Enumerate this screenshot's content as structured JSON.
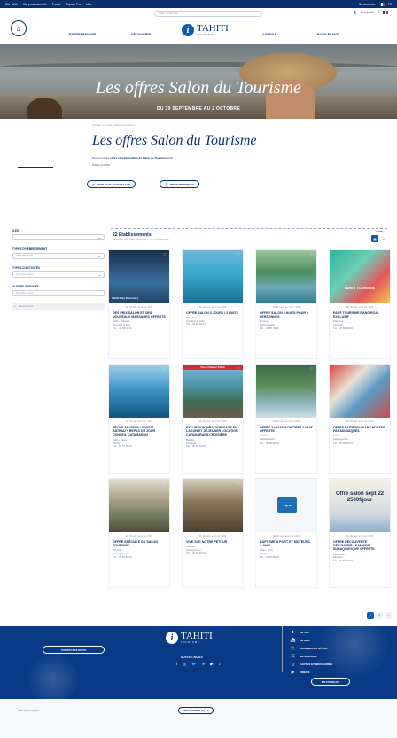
{
  "topbar": {
    "links": [
      "Site Tahiti",
      "Site professionnels",
      "Presse",
      "Espace Pro",
      "Mice"
    ],
    "right_text": "Se connecter",
    "lang": "FR"
  },
  "header": {
    "search_placeholder": "Votre recherche...",
    "login": "Connexion",
    "nav": [
      "ENTREPRENDRE",
      "DÉCOUVRIR",
      "AGENDA",
      "BONS PLANS"
    ],
    "logo_word": "TAHITI",
    "logo_sub": "TOURISME"
  },
  "hero": {
    "title": "Les offres Salon du Tourisme",
    "dates": "DU 30 SEPTEMBRE AU 2 OCTOBRE"
  },
  "intro": {
    "breadcrumb": "Accueil > Les offres Salon du Tourisme",
    "title": "Les offres Salon du Tourisme",
    "text_prefix": "Découvrez les",
    "text_bold": "offres exceptionnelles du Salon du Tourisme",
    "text_suffix": "2022",
    "date": "Publié le 01/09",
    "btn_map": "VOIR LE PLAN DU SALON",
    "btn_info": "INFOS PRATIQUES"
  },
  "filters": {
    "items": [
      {
        "label": "ÎLES",
        "value": ""
      },
      {
        "label": "TYPES D'HÉBERGEMENT",
        "value": "Tous les types"
      },
      {
        "label": "TYPES D'ACTIVITÉS",
        "value": "Tous les types"
      },
      {
        "label": "AUTRES SERVICES",
        "value": "Tous les types"
      }
    ],
    "search_placeholder": "Rechercher"
  },
  "results": {
    "count": "22 Établissements",
    "subtitle": "Résultats pour votre recherche — 22 offres au total",
    "view_label": "LISTE"
  },
  "cards": [
    {
      "date": "Du 30 sept. au 2 oct. 2022",
      "title": "DES PRIX SALON ET DES NOUVEAUX MASSAGES OFFERTS",
      "meta": [
        "Tahiti - Papeete",
        "Bien-être & Spa",
        "Tél. : 40 50 10 00"
      ],
      "img": "whale",
      "img_text": "Tahiti Dive Discovery"
    },
    {
      "date": "Du 30 sept. au 2 oct. 2022",
      "title": "OFFRE SALON 3 JOURS / 2 NUITS",
      "meta": [
        "Bora Bora",
        "Croisière & Voile",
        "Tél. : 40 60 20 00"
      ],
      "img": "lagoon",
      "img_text": ""
    },
    {
      "date": "Du 30 sept. au 2 oct. 2022",
      "title": "OFFRE SALON 3 NUITS POUR 2 PERSONNES",
      "meta": [
        "Moorea",
        "Hébergement",
        "Tél. : 40 55 10 10"
      ],
      "img": "resort",
      "img_text": ""
    },
    {
      "date": "Du 30 sept. au 2 oct. 2022",
      "title": "PASS TOURISME RANGIROA EXCLUSIF",
      "meta": [
        "Rangiroa",
        "Activités",
        "Tél. : 40 96 00 00"
      ],
      "img": "pass",
      "img_text": "TAHITI TOURISME"
    },
    {
      "date": "Du 30 sept. au 2 oct. 2022",
      "title": "PÊCHE AU GROS / SORTIE BATEAU + REPAS DU JOUR CONSEIL CATAMARAN",
      "meta": [
        "Tahiti - Faa'a",
        "Pêche",
        "Tél. : 87 70 00 00"
      ],
      "img": "boat",
      "img_text": ""
    },
    {
      "date": "Du 30 sept. au 2 oct. 2022",
      "title": "EXCURSION PIRATAGE NAGE EN LAGON ET DÉJEUNER LOCATION CATAMARANS CROISIÈRE",
      "meta": [
        "Raiatea",
        "Croisière",
        "Tél. : 40 66 00 00"
      ],
      "img": "pier",
      "img_text": "Pass Charter Tahiti"
    },
    {
      "date": "Du 30 sept. au 2 oct. 2022",
      "title": "OFFRE 3 NUITS ACHETÉES 1 NUIT OFFERTE",
      "meta": [
        "Huahine",
        "Hébergement",
        "Tél. : 40 68 00 00"
      ],
      "img": "palms",
      "img_text": ""
    },
    {
      "date": "Du 30 sept. au 2 oct. 2022",
      "title": "OFFRE FAITE POUR LES POSTES PARADISIAQUES",
      "meta": [
        "Tahaa",
        "Hébergement",
        "Tél. : 40 65 00 00"
      ],
      "img": "collage",
      "img_text": ""
    },
    {
      "date": "Du 30 sept. au 2 oct. 2022",
      "title": "OFFRE SPÉCIALE DU SALON TOURISME",
      "meta": [
        "Moorea",
        "Hébergement",
        "Tél. : 40 56 00 00"
      ],
      "img": "room",
      "img_text": ""
    },
    {
      "date": "Du 30 sept. au 2 oct. 2022",
      "title": "VIVE SUR NOTRE PÉTOUR",
      "meta": [
        "Tikehau",
        "Hébergement",
        "Tél. : 40 96 22 00"
      ],
      "img": "bungalow",
      "img_text": ""
    },
    {
      "date": "Du 30 sept. au 2 oct. 2022",
      "title": "BAPTÊME À PORT ET MOTEURS À AHIÉ",
      "meta": [
        "Tahiti - Arue",
        "Plongée",
        "Tél. : 87 20 00 00"
      ],
      "img": "logo",
      "img_text": "Aqua"
    },
    {
      "date": "Du 30 sept. au 2 oct. 2022",
      "title": "OFFRE DÉCOUVERTE DÉCOUVRIR LE MONDE SUBAQUATIQUE OFFERTE",
      "meta": [
        "Bora Bora",
        "Plongée",
        "Tél. : 40 67 00 00"
      ],
      "img": "salon",
      "img_text": "Offre salon sept 22 2500f/jour"
    }
  ],
  "pager": [
    "1",
    "2",
    "›"
  ],
  "footer": {
    "contact": "CONTACTEZ-NOUS",
    "logo_word": "TAHITI",
    "logo_sub": "TOURISME",
    "follow": "SUIVEZ-NOUS",
    "links": [
      "EN VOL",
      "EN MER",
      "CHAMBRES D'HÔTES",
      "BROCHURES",
      "CARTES ET BROCHURES",
      "VIDÉOS"
    ],
    "lang_btn": "EN FRANÇAIS"
  },
  "bottom": {
    "legal": "Mentions légales",
    "favorites": "MES FAVORIS (0)"
  },
  "colors": {
    "brand": "#0b2f6b",
    "accent": "#0b5fb3",
    "footer": "#0a3a86"
  }
}
